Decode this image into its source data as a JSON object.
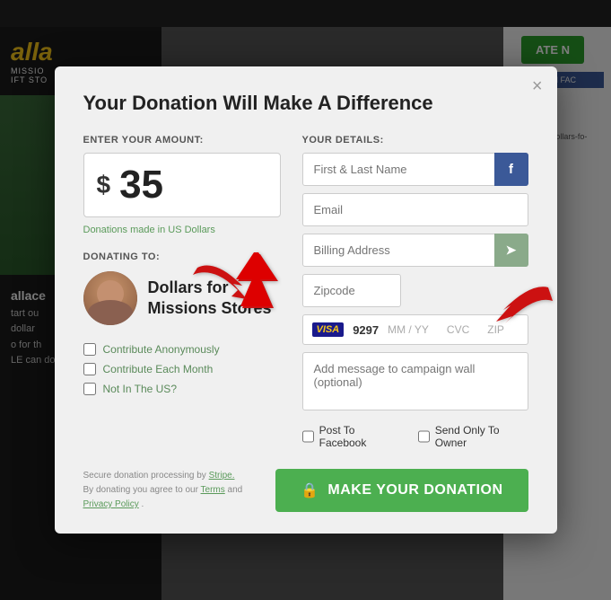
{
  "modal": {
    "title": "Your Donation Will Make A Difference",
    "close_label": "×",
    "amount_section_label": "ENTER YOUR AMOUNT:",
    "currency_symbol": "$",
    "amount_value": "35",
    "amount_note": "Donations made in US Dollars",
    "donating_label": "DONATING TO:",
    "recipient_name": "Dollars for Missions Stores",
    "checkboxes": [
      {
        "label": "Contribute Anonymously"
      },
      {
        "label": "Contribute Each Month"
      },
      {
        "label": "Not In The US?"
      }
    ],
    "details_section_label": "YOUR DETAILS:",
    "fields": {
      "name_placeholder": "First & Last Name",
      "email_placeholder": "Email",
      "billing_placeholder": "Billing Address",
      "zipcode_placeholder": "Zipcode",
      "message_placeholder": "Add message to campaign wall (optional)"
    },
    "card": {
      "brand": "VISA",
      "number": "9297",
      "mm_yy": "MM / YY",
      "cvc": "CVC",
      "zip": "ZIP"
    },
    "social": {
      "post_facebook": "Post To Facebook",
      "send_only_owner": "Send Only To Owner"
    },
    "footer": {
      "secure_text": "Secure donation processing by ",
      "stripe_link": "Stripe.",
      "terms_text": "By donating you agree to our ",
      "terms_link": "Terms",
      "and_text": " and ",
      "privacy_link": "Privacy Policy",
      "period": "."
    },
    "donate_button": "MAKE YOUR DONATION"
  }
}
